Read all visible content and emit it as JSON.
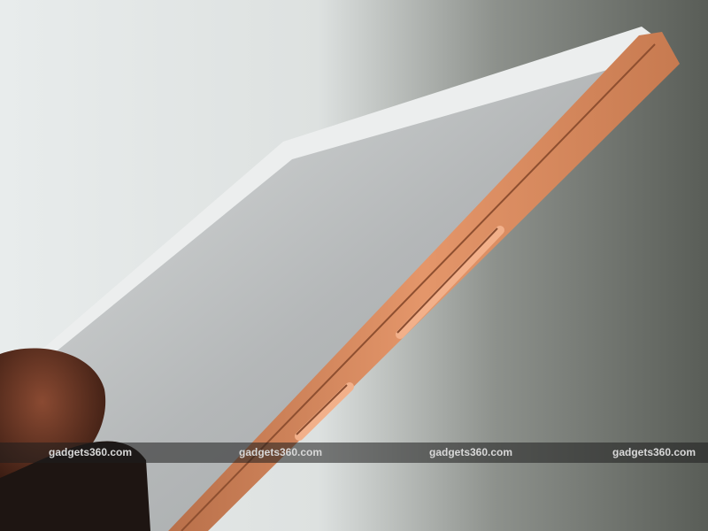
{
  "watermark": {
    "text": "gadgets360.com",
    "items": [
      "gadgets360.com",
      "gadgets360.com",
      "gadgets360.com",
      "gadgets360.com"
    ]
  },
  "colors": {
    "background_light": "#e6eaea",
    "background_dark": "#5e625c",
    "copper_edge": "#d98a5c",
    "screen_glass": "#b9bcbc"
  }
}
